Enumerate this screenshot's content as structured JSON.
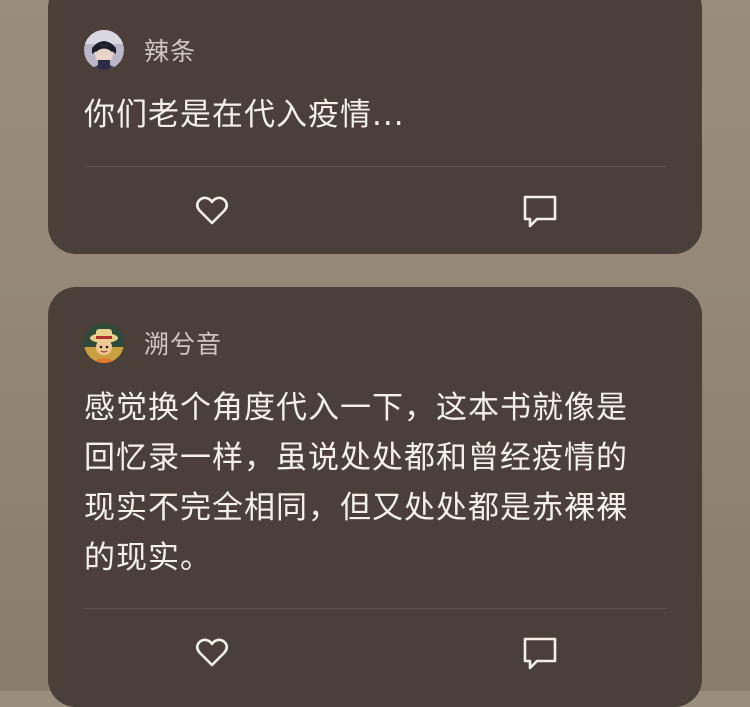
{
  "posts": [
    {
      "username": "辣条",
      "text": "你们老是在代入疫情..."
    },
    {
      "username": "溯兮音",
      "text": "感觉换个角度代入一下，这本书就像是回忆录一样，虽说处处都和曾经疫情的现实不完全相同，但又处处都是赤裸裸的现实。"
    }
  ],
  "icons": {
    "like": "heart-icon",
    "comment": "comment-icon"
  },
  "colors": {
    "card_background": "#4a4039",
    "page_background": "#958878",
    "text_primary": "#f4f0ec",
    "text_secondary": "#cfc7bf",
    "icon_color": "#f4f0ec"
  }
}
